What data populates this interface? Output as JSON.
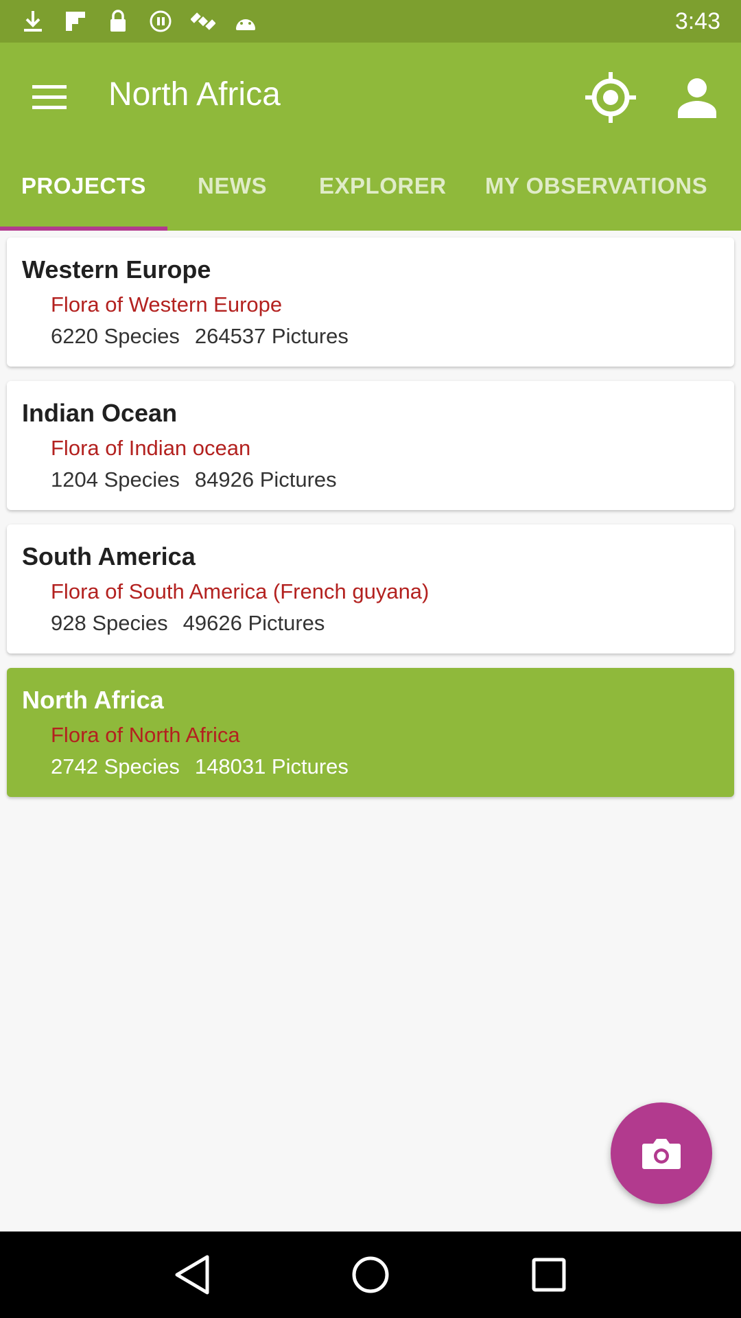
{
  "status_bar": {
    "time": "3:43",
    "icons": [
      "download-icon",
      "flipboard-icon",
      "lock-icon",
      "record-icon",
      "satellite-icon",
      "android-icon"
    ]
  },
  "app_bar": {
    "title": "North Africa",
    "actions": [
      "location-icon",
      "account-icon"
    ]
  },
  "tabs": [
    {
      "label": "PROJECTS",
      "active": true
    },
    {
      "label": "NEWS",
      "active": false
    },
    {
      "label": "EXPLORER",
      "active": false
    },
    {
      "label": "MY OBSERVATIONS",
      "active": false
    }
  ],
  "projects": [
    {
      "region": "Western Europe",
      "flora": "Flora of Western Europe",
      "species": "6220 Species",
      "pictures": "264537 Pictures",
      "selected": false
    },
    {
      "region": "Indian Ocean",
      "flora": "Flora of Indian ocean",
      "species": "1204 Species",
      "pictures": "84926 Pictures",
      "selected": false
    },
    {
      "region": "South America",
      "flora": "Flora of South America (French guyana)",
      "species": "928 Species",
      "pictures": "49626 Pictures",
      "selected": false
    },
    {
      "region": "North Africa",
      "flora": "Flora of North Africa",
      "species": "2742 Species",
      "pictures": "148031 Pictures",
      "selected": true
    }
  ],
  "fab": {
    "icon": "camera-icon"
  },
  "colors": {
    "primary": "#8fb93b",
    "accent": "#b23a8e",
    "flora_text": "#b3211f"
  }
}
